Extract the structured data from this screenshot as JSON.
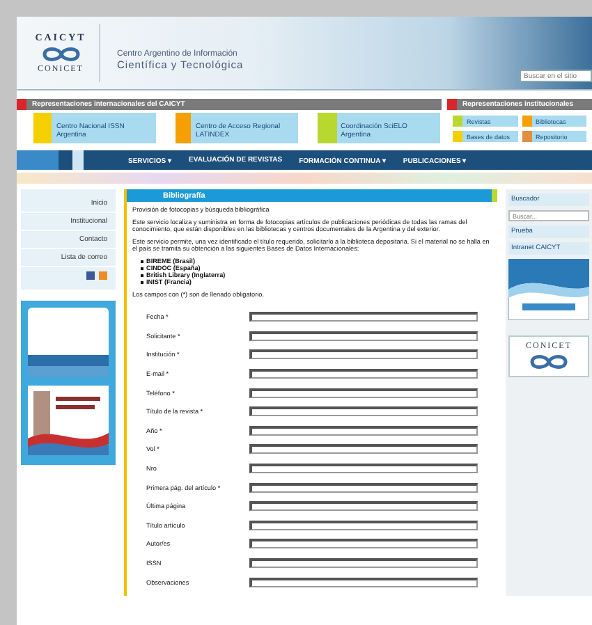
{
  "header": {
    "logo_top": "CAICYT",
    "logo_bottom": "CONICET",
    "title_line1": "Centro Argentino de Información",
    "title_line2": "Científica y Tecnológica",
    "search": {
      "placeholder": "Buscar en el sitio"
    }
  },
  "representations": {
    "international_title": "Representaciones internacionales del CAICYT",
    "international": [
      {
        "text": "Centro Nacional ISSN Argentina",
        "color": "#f5d000"
      },
      {
        "text": "Centro de Acceso Regional LATINDEX",
        "color": "#f5a000"
      },
      {
        "text": "Coordinación SciELO Argentina",
        "color": "#b8d830"
      }
    ],
    "institutional_title": "Representaciones institucionales",
    "institutional": [
      {
        "text": "Revistas",
        "color": "#b8d830"
      },
      {
        "text": "Bibliotecas",
        "color": "#f5a000"
      },
      {
        "text": "Bases de datos",
        "color": "#f5d000"
      },
      {
        "text": "Repositorio",
        "color": "#e09040"
      }
    ]
  },
  "nav": [
    {
      "label": "SERVICIOS ▾"
    },
    {
      "label": "EVALUACIÓN DE REVISTAS"
    },
    {
      "label": "FORMACIÓN CONTINUA ▾"
    },
    {
      "label": "PUBLICACIONES ▾"
    }
  ],
  "sidebar": {
    "items": [
      {
        "label": "Inicio"
      },
      {
        "label": "Institucional"
      },
      {
        "label": "Contacto"
      },
      {
        "label": "Lista de correo"
      }
    ]
  },
  "content": {
    "title": "Bibliografía",
    "subtitle": "Provisión de fotocopias y búsqueda bibliográfica",
    "paragraphs": [
      "Este servicio localiza y suministra en forma de fotocopias artículos de publicaciones periódicas de todas las ramas del conocimiento, que están disponibles en las bibliotecas y centros documentales de la Argentina y del exterior.",
      "Este servicio permite, una vez identificado el título requerido, solicitarlo a la biblioteca depositaria. Si el material no se halla en el país se tramita su obtención a las siguientes Bases de Datos Internacionales:"
    ],
    "sources": [
      "BIREME (Brasil)",
      "CINDOC (España)",
      "British Library (Inglaterra)",
      "INIST (Francia)"
    ],
    "note": "Los campos con (*) son de llenado obligatorio.",
    "fields": [
      {
        "label": "Fecha *"
      },
      {
        "label": "Solicitante *"
      },
      {
        "label": "Institución *"
      },
      {
        "label": "E-mail *"
      },
      {
        "label": "Teléfono *"
      },
      {
        "label": "Título de la revista *"
      },
      {
        "label": "Año *"
      },
      {
        "label": "Vol *"
      },
      {
        "label": "Nro"
      },
      {
        "label": "Primera pág. del artículo *"
      },
      {
        "label": "Última página"
      },
      {
        "label": "Título artículo"
      },
      {
        "label": "Autor/es"
      },
      {
        "label": "ISSN"
      },
      {
        "label": "Observaciones"
      }
    ]
  },
  "right": {
    "title": "Buscador",
    "search": {
      "placeholder": "Buscar..."
    },
    "links": [
      {
        "label": "Prueba"
      },
      {
        "label": "Intranet CAICYT"
      }
    ],
    "banner_logo": "CONICET"
  }
}
